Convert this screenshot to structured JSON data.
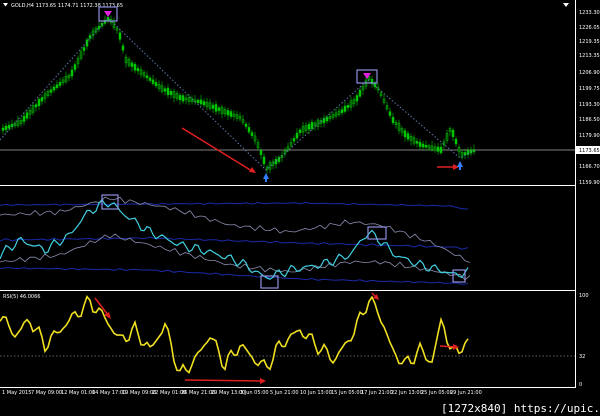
{
  "window": {
    "symbol_header": "GOLD,H4  1173.65 1174.71 1172.38 1173.65",
    "menu_icon": "triangle-down-icon",
    "corner_icon": "triangle-down-icon"
  },
  "price_panel": {
    "current_price_label": "1173.65",
    "ticks": [
      "1233.30",
      "1226.05",
      "1219.35",
      "1213.35",
      "1206.90",
      "1199.75",
      "1193.30",
      "1186.50",
      "1179.90",
      "1173.65",
      "1166.70",
      "1159.90"
    ]
  },
  "rsi_panel": {
    "label": "RSI(5) 46.0066",
    "ticks": [
      "100",
      "32",
      "0"
    ]
  },
  "time_axis": {
    "labels": [
      "1 May 2015",
      "7 May 09:00",
      "12 May 01:00",
      "14 May 17:00",
      "19 May 09:00",
      "22 May 01:00",
      "26 May 21:00",
      "29 May 13:00",
      "3 Jun 05:00",
      "5 Jun 21:00",
      "10 Jun 13:00",
      "15 Jun 05:00",
      "17 Jun 21:00",
      "22 Jun 13:00",
      "25 Jun 05:00",
      "29 Jun 21:00"
    ]
  },
  "watermark": {
    "text": "[1272x840] https://upic.me/"
  },
  "colors": {
    "background": "#000000",
    "candles": "#00c800",
    "current_price_line": "#808080",
    "zigzag_dots": "#5a7aa8",
    "cyan_line": "#3fd0e0",
    "band_blue": "#1a2aa8",
    "band_gray": "#8a8fb0",
    "rsi_line": "#f0e020",
    "divergence_arrow": "#e02020",
    "box_stroke": "#8f8fe0",
    "magenta_arrow": "#e020e0",
    "blue_arrow": "#3080ff"
  }
}
